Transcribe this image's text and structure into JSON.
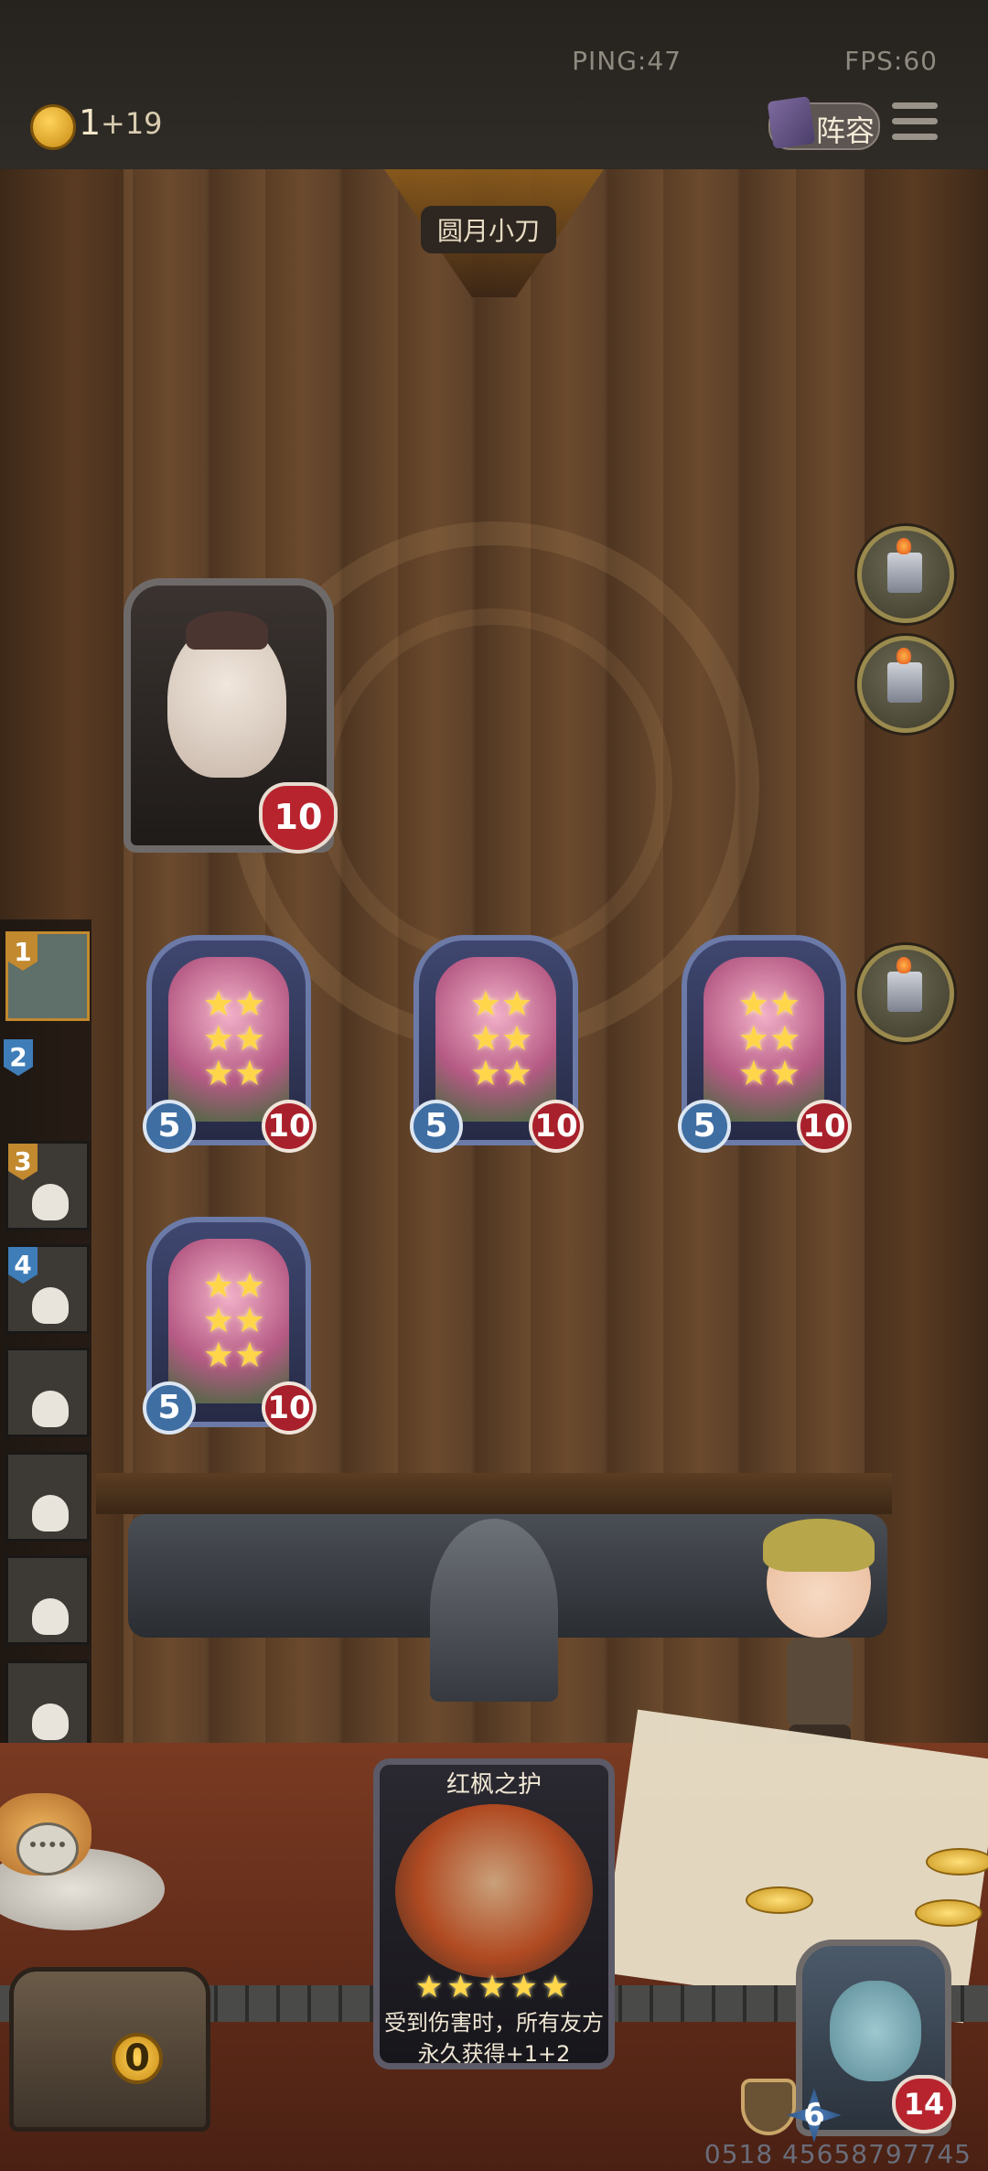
{
  "status": {
    "ping": "PING:47",
    "fps": "FPS:60"
  },
  "top": {
    "coin_count": "1",
    "coin_bonus": "+19",
    "lineup_label": "阵容"
  },
  "opponent": {
    "name": "圆月小刀",
    "health": "10"
  },
  "board_minions": [
    {
      "attack": "5",
      "health": "10",
      "stars": "★★\n★★\n★★"
    },
    {
      "attack": "5",
      "health": "10",
      "stars": "★★\n★★\n★★"
    },
    {
      "attack": "5",
      "health": "10",
      "stars": "★★\n★★\n★★"
    },
    {
      "attack": "5",
      "health": "10",
      "stars": "★★\n★★\n★★"
    }
  ],
  "rankings": [
    {
      "rank": "1",
      "eliminated": false
    },
    {
      "rank": "2",
      "eliminated": false
    },
    {
      "rank": "3",
      "eliminated": true
    },
    {
      "rank": "4",
      "eliminated": true
    },
    {
      "rank": "",
      "eliminated": true
    },
    {
      "rank": "",
      "eliminated": true
    },
    {
      "rank": "",
      "eliminated": true
    },
    {
      "rank": "",
      "eliminated": true
    }
  ],
  "offer_card": {
    "title": "红枫之护",
    "stars": "★★★★★",
    "description": "受到伤害时，所有友方永久获得+1+2"
  },
  "chest": {
    "coins": "0"
  },
  "player": {
    "armor_icon": "shield-icon",
    "attack": "6",
    "health": "14"
  },
  "footer": {
    "uid": "0518 45658797745"
  },
  "colors": {
    "gold": "#ffd35a",
    "health_red": "#b8242e",
    "attack_blue": "#3f6ea3"
  }
}
